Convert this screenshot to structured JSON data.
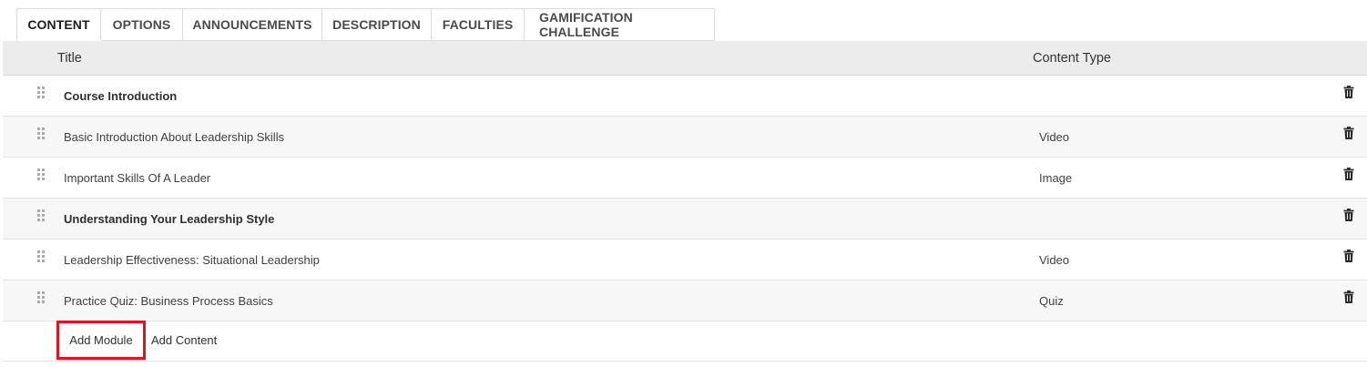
{
  "tabs": [
    {
      "label": "CONTENT",
      "active": true
    },
    {
      "label": "OPTIONS",
      "active": false
    },
    {
      "label": "ANNOUNCEMENTS",
      "active": false
    },
    {
      "label": "DESCRIPTION",
      "active": false
    },
    {
      "label": "FACULTIES",
      "active": false
    },
    {
      "label": "GAMIFICATION CHALLENGE",
      "active": false
    }
  ],
  "table": {
    "columns": {
      "title": "Title",
      "content_type": "Content Type"
    },
    "rows": [
      {
        "title": "Course Introduction",
        "type": "",
        "kind": "module",
        "icons": [
          "drag-handle-icon",
          "trash-icon"
        ]
      },
      {
        "title": "Basic Introduction About Leadership Skills",
        "type": "Video",
        "kind": "content",
        "icons": [
          "drag-handle-icon",
          "trash-icon"
        ]
      },
      {
        "title": "Important Skills Of A Leader",
        "type": "Image",
        "kind": "content",
        "icons": [
          "drag-handle-icon",
          "trash-icon"
        ]
      },
      {
        "title": "Understanding Your Leadership Style",
        "type": "",
        "kind": "module",
        "icons": [
          "drag-handle-icon",
          "trash-icon"
        ]
      },
      {
        "title": "Leadership Effectiveness: Situational Leadership",
        "type": "Video",
        "kind": "content",
        "icons": [
          "drag-handle-icon",
          "trash-icon"
        ]
      },
      {
        "title": "Practice Quiz: Business Process Basics",
        "type": "Quiz",
        "kind": "content",
        "icons": [
          "drag-handle-icon",
          "trash-icon"
        ]
      }
    ]
  },
  "actions": {
    "add_module": "Add Module",
    "add_content": "Add Content"
  },
  "colors": {
    "highlight": "#e0141e",
    "header_bg": "#ececec",
    "alt_row_bg": "#f7f7f7"
  }
}
